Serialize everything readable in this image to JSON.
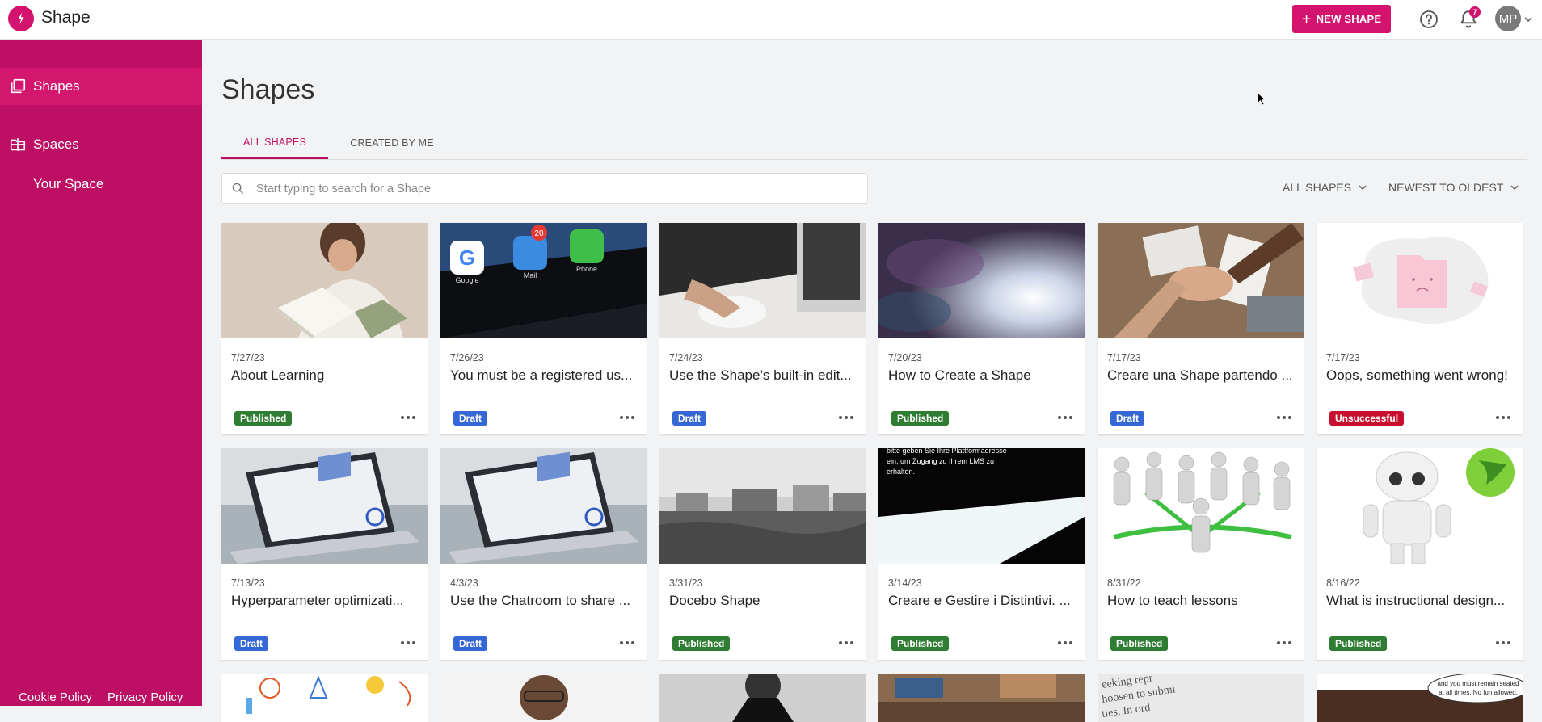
{
  "app": {
    "name": "Shape"
  },
  "topbar": {
    "new_shape_label": "NEW SHAPE",
    "notification_count": "7",
    "avatar_initials": "MP"
  },
  "sidebar": {
    "shapes_label": "Shapes",
    "spaces_label": "Spaces",
    "your_space_label": "Your Space",
    "cookie_policy": "Cookie Policy",
    "privacy_policy": "Privacy Policy"
  },
  "main": {
    "title": "Shapes",
    "tabs": [
      {
        "label": "ALL SHAPES"
      },
      {
        "label": "CREATED BY ME"
      }
    ],
    "search_placeholder": "Start typing to search for a Shape",
    "filter_type": "ALL SHAPES",
    "sort_order": "NEWEST TO OLDEST"
  },
  "cards": [
    {
      "date": "7/27/23",
      "title": "About Learning",
      "status": "Published"
    },
    {
      "date": "7/26/23",
      "title": "You must be a registered us...",
      "status": "Draft"
    },
    {
      "date": "7/24/23",
      "title": "Use the Shape’s built-in edit...",
      "status": "Draft"
    },
    {
      "date": "7/20/23",
      "title": "How to Create a Shape",
      "status": "Published"
    },
    {
      "date": "7/17/23",
      "title": "Creare una Shape partendo ...",
      "status": "Draft"
    },
    {
      "date": "7/17/23",
      "title": "Oops, something went wrong!",
      "status": "Unsuccessful"
    },
    {
      "date": "7/13/23",
      "title": "Hyperparameter optimizati...",
      "status": "Draft"
    },
    {
      "date": "4/3/23",
      "title": "Use the Chatroom to share ...",
      "status": "Draft"
    },
    {
      "date": "3/31/23",
      "title": "Docebo Shape",
      "status": "Published"
    },
    {
      "date": "3/14/23",
      "title": "Creare e Gestire i Distintivi. ...",
      "status": "Published"
    },
    {
      "date": "8/31/22",
      "title": "How to teach lessons",
      "status": "Published"
    },
    {
      "date": "8/16/22",
      "title": "What is instructional design...",
      "status": "Published"
    }
  ],
  "thumb_text": {
    "card2_apps": [
      "Google",
      "Mail",
      "Phone"
    ],
    "card2_badge": "20",
    "card10_lines": [
      "bitte geben Sie Ihre Plattformadresse",
      "ein, um Zugang zu Ihrem LMS zu",
      "erhalten."
    ],
    "row3_card6_lines": [
      "and you must remain seated",
      "at all times. No fun allowed."
    ],
    "row3_card5_lines": [
      "eeking repr",
      "hoosen to submi",
      "ties. In ord"
    ]
  },
  "colors": {
    "brand": "#bd0f63",
    "brand_light": "#d3136e",
    "published": "#2f7d32",
    "draft": "#3567d6",
    "unsuccessful": "#c8102e"
  }
}
